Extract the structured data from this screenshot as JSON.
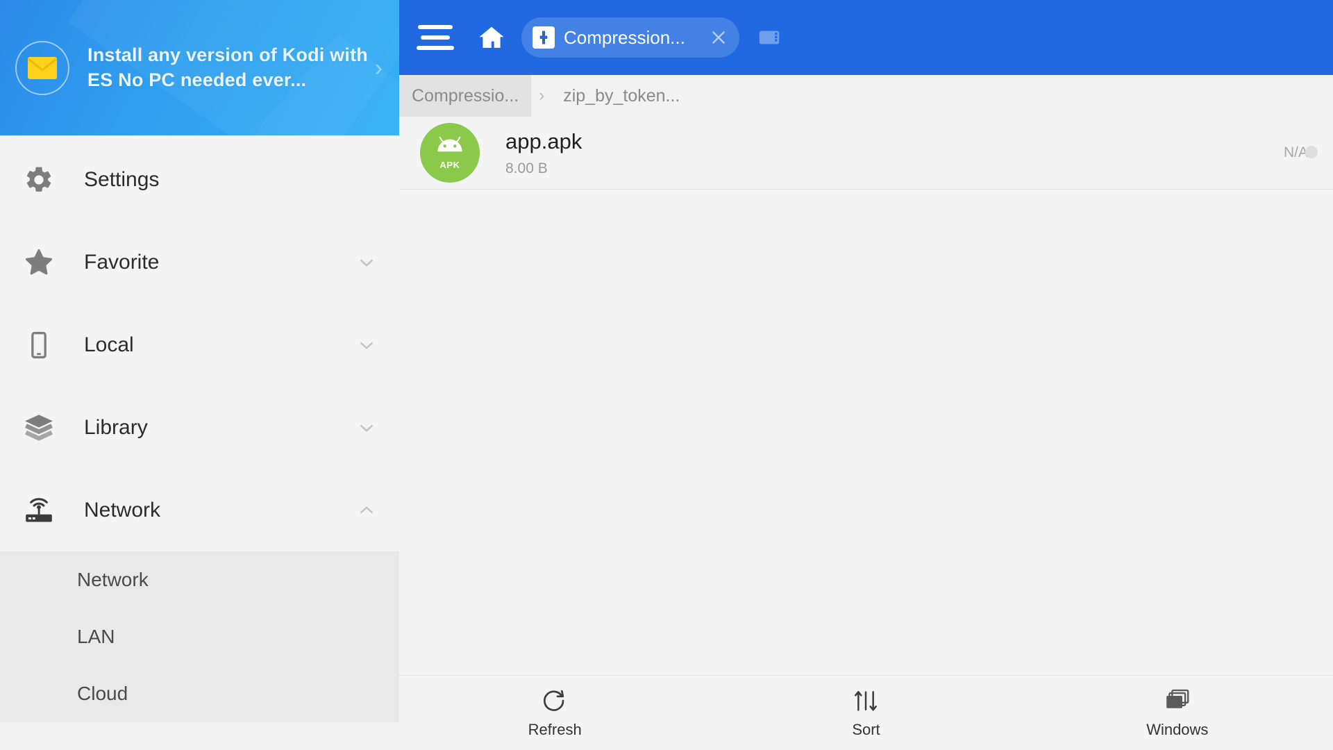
{
  "promo": {
    "icon": "envelope-icon",
    "text": "Install any version of Kodi with ES No PC needed ever...",
    "arrow": "›"
  },
  "sidebar": {
    "items": [
      {
        "label": "Settings",
        "icon": "gear-icon",
        "chevron": ""
      },
      {
        "label": "Favorite",
        "icon": "star-icon",
        "chevron": "down"
      },
      {
        "label": "Local",
        "icon": "phone-icon",
        "chevron": "down"
      },
      {
        "label": "Library",
        "icon": "layers-icon",
        "chevron": "down"
      },
      {
        "label": "Network",
        "icon": "router-icon",
        "chevron": "up"
      }
    ],
    "network_subitems": [
      {
        "label": "Network"
      },
      {
        "label": "LAN"
      },
      {
        "label": "Cloud"
      }
    ]
  },
  "topbar": {
    "menu_icon": "hamburger-icon",
    "home_icon": "home-icon",
    "new_tab_icon": "new-window-icon",
    "tab": {
      "title": "Compression...",
      "favicon": "compression-icon",
      "close_label": "✕"
    }
  },
  "breadcrumb": {
    "separator": "›",
    "items": [
      {
        "label": "Compressio...",
        "active": true
      },
      {
        "label": "zip_by_token...",
        "active": false
      }
    ]
  },
  "files": {
    "rows": [
      {
        "name": "app.apk",
        "size": "8.00 B",
        "status": "N/A",
        "icon": "apk-icon",
        "icon_tag": "APK",
        "icon_color": "#8bc94b"
      }
    ]
  },
  "bottombar": {
    "buttons": [
      {
        "label": "Refresh",
        "icon": "refresh-icon"
      },
      {
        "label": "Sort",
        "icon": "sort-icon"
      },
      {
        "label": "Windows",
        "icon": "windows-icon"
      }
    ]
  },
  "colors": {
    "header_blue": "#2069e0",
    "banner_blue": "#31a0f0",
    "apk_green": "#8bc94b",
    "page_bg": "#f2f2f2"
  }
}
